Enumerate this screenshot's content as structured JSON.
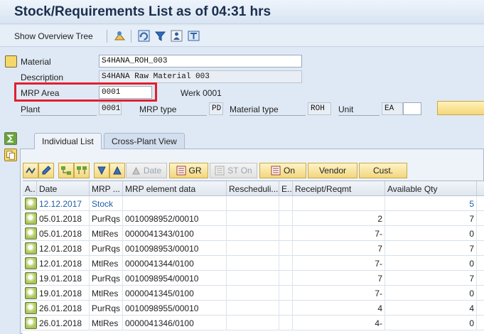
{
  "window": {
    "title": "Stock/Requirements List as of 04:31 hrs"
  },
  "toolbar": {
    "show_overview_tree": "Show Overview Tree",
    "icons": [
      "overview-tree-icon",
      "refresh-icon",
      "filter-icon",
      "user-settings-icon",
      "export-icon"
    ]
  },
  "header": {
    "material_label": "Material",
    "material_value": "S4HANA_ROH_003",
    "description_label": "Description",
    "description_value": "S4HANA Raw Material 003",
    "mrp_area_label": "MRP Area",
    "mrp_area_value": "0001",
    "werk_text": "Werk 0001",
    "plant_label": "Plant",
    "plant_value": "0001",
    "mrp_type_label": "MRP type",
    "mrp_type_value": "PD",
    "material_type_label": "Material type",
    "material_type_value": "ROH",
    "unit_label": "Unit",
    "unit_value": "EA",
    "highlight_color": "#e0202e"
  },
  "tabs": [
    {
      "label": "Individual List",
      "active": true
    },
    {
      "label": "Cross-Plant View",
      "active": false
    }
  ],
  "alv_toolbar": {
    "date_label": "Date",
    "gr_label": "GR",
    "st_on_label": "ST On",
    "on_label": "On",
    "vendor_label": "Vendor",
    "cust_label": "Cust."
  },
  "grid": {
    "columns": [
      "A..",
      "Date",
      "MRP ...",
      "MRP element data",
      "Rescheduli...",
      "E..",
      "Receipt/Reqmt",
      "Available Qty"
    ],
    "rows": [
      {
        "date": "12.12.2017",
        "mrp": "Stock",
        "element": "",
        "resched": "",
        "e": "",
        "receipt": "",
        "available": "5"
      },
      {
        "date": "05.01.2018",
        "mrp": "PurRqs",
        "element": "0010098952/00010",
        "resched": "",
        "e": "",
        "receipt": "2",
        "available": "7"
      },
      {
        "date": "05.01.2018",
        "mrp": "MtlRes",
        "element": "0000041343/0100",
        "resched": "",
        "e": "",
        "receipt": "7-",
        "available": "0"
      },
      {
        "date": "12.01.2018",
        "mrp": "PurRqs",
        "element": "0010098953/00010",
        "resched": "",
        "e": "",
        "receipt": "7",
        "available": "7"
      },
      {
        "date": "12.01.2018",
        "mrp": "MtlRes",
        "element": "0000041344/0100",
        "resched": "",
        "e": "",
        "receipt": "7-",
        "available": "0"
      },
      {
        "date": "19.01.2018",
        "mrp": "PurRqs",
        "element": "0010098954/00010",
        "resched": "",
        "e": "",
        "receipt": "7",
        "available": "7"
      },
      {
        "date": "19.01.2018",
        "mrp": "MtlRes",
        "element": "0000041345/0100",
        "resched": "",
        "e": "",
        "receipt": "7-",
        "available": "0"
      },
      {
        "date": "26.01.2018",
        "mrp": "PurRqs",
        "element": "0010098955/00010",
        "resched": "",
        "e": "",
        "receipt": "4",
        "available": "4"
      },
      {
        "date": "26.01.2018",
        "mrp": "MtlRes",
        "element": "0000041346/0100",
        "resched": "",
        "e": "",
        "receipt": "4-",
        "available": "0"
      }
    ]
  }
}
